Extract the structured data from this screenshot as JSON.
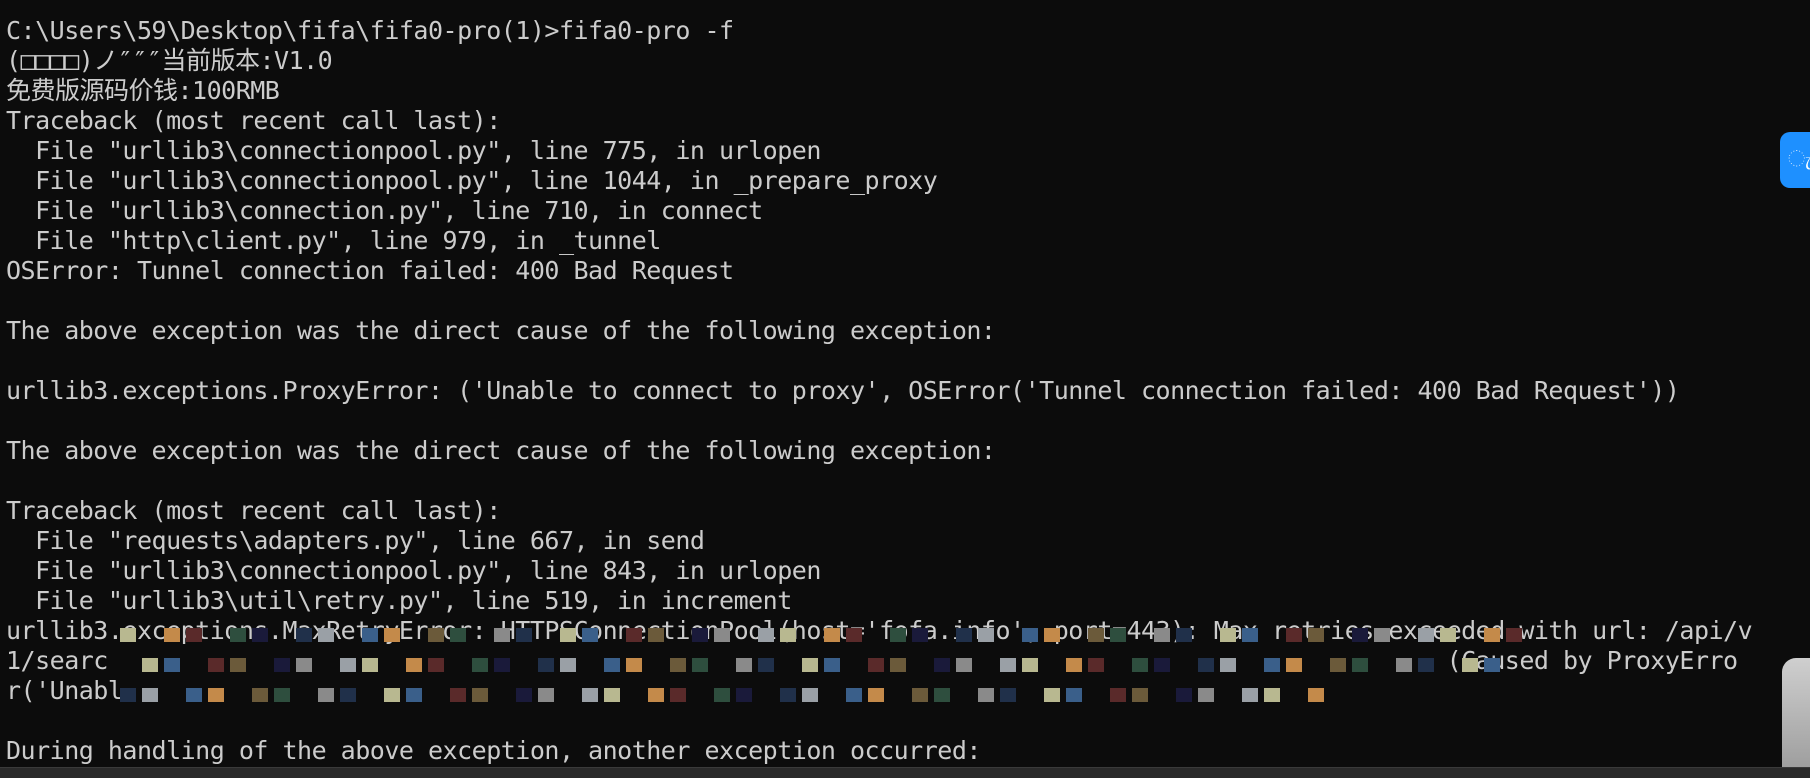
{
  "terminal": {
    "lines": [
      "C:\\Users\\59\\Desktop\\fifa\\fifa0-pro(1)>fifa0-pro -f",
      "(□□□□)ノ″″″当前版本:V1.0",
      "免费版源码价钱:100RMB",
      "Traceback (most recent call last):",
      "  File \"urllib3\\connectionpool.py\", line 775, in urlopen",
      "  File \"urllib3\\connectionpool.py\", line 1044, in _prepare_proxy",
      "  File \"urllib3\\connection.py\", line 710, in connect",
      "  File \"http\\client.py\", line 979, in _tunnel",
      "OSError: Tunnel connection failed: 400 Bad Request",
      "",
      "The above exception was the direct cause of the following exception:",
      "",
      "urllib3.exceptions.ProxyError: ('Unable to connect to proxy', OSError('Tunnel connection failed: 400 Bad Request'))",
      "",
      "The above exception was the direct cause of the following exception:",
      "",
      "Traceback (most recent call last):",
      "  File \"requests\\adapters.py\", line 667, in send",
      "  File \"urllib3\\connectionpool.py\", line 843, in urlopen",
      "  File \"urllib3\\util\\retry.py\", line 519, in increment",
      "urllib3.exceptions.MaxRetryError: HTTPSConnectionPool(host='fofa.info', port=443): Max retries exceeded with url: /api/v",
      "1/searc                                                                                            (Caused by ProxyErro",
      "r('Unabl",
      "",
      "During handling of the above exception, another exception occurred:"
    ]
  },
  "widgets": {
    "right_edge_icon": "link-icon",
    "right_edge_glyph": "ැ"
  },
  "colors": {
    "background": "#0c0c0c",
    "foreground": "#cccccc"
  }
}
